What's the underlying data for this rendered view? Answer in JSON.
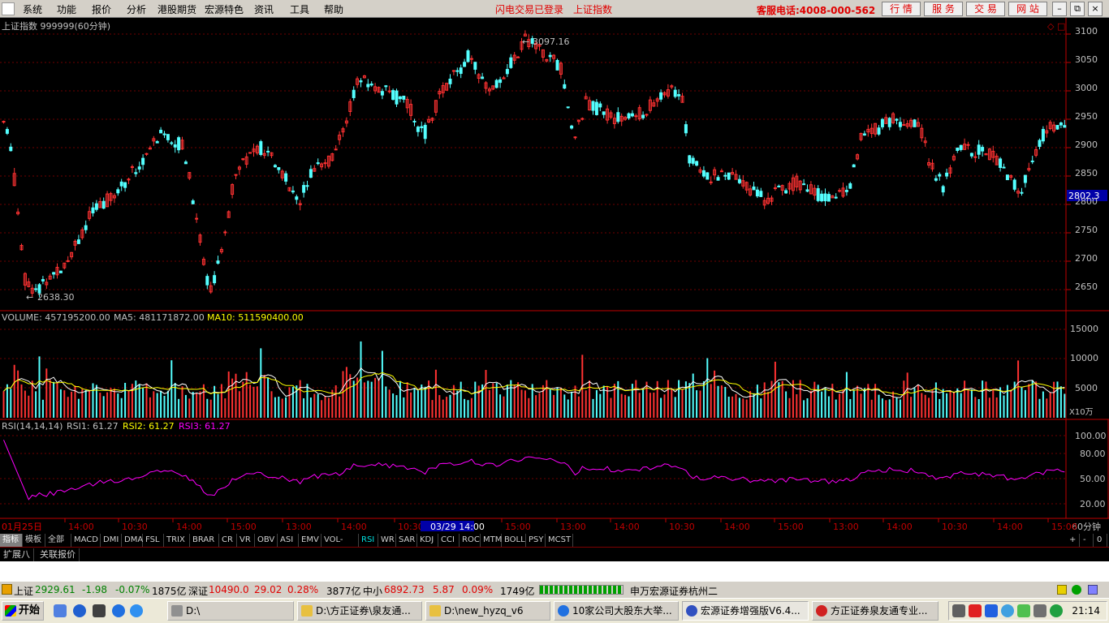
{
  "menubar": {
    "items": [
      "系统",
      "功能",
      "报价",
      "分析",
      "港股期货",
      "宏源特色",
      "资讯",
      "工具",
      "帮助"
    ],
    "status_login": "闪电交易已登录",
    "status_index": "上证指数",
    "hotline": "客服电话:4008-000-562",
    "right_buttons": [
      "行 情",
      "服 务",
      "交 易",
      "网 站"
    ],
    "window_buttons": [
      "minimize",
      "restore",
      "close"
    ]
  },
  "chart": {
    "title": "上证指数 999999(60分钟)",
    "high_label": "3097.16",
    "low_label": "2638.30",
    "current_price": "2802.3",
    "price_ticks": [
      "3100",
      "3050",
      "3000",
      "2950",
      "2900",
      "2850",
      "2800",
      "2750",
      "2700",
      "2650"
    ],
    "volume_label": "VOLUME: 457195200.00",
    "ma5_label": "MA5: 481171872.00",
    "ma10_label": "MA10: 511590400.00",
    "volume_ticks": [
      "15000",
      "10000",
      "5000"
    ],
    "volume_unit": "X10万",
    "rsi_label": "RSI(14,14,14)",
    "rsi1_label": "RSI1: 61.27",
    "rsi2_label": "RSI2: 61.27",
    "rsi3_label": "RSI3: 61.27",
    "rsi_ticks": [
      "100.00",
      "80.00",
      "50.00",
      "20.00"
    ],
    "time_labels": [
      "01月25日",
      "14:00",
      "10:30",
      "14:00",
      "15:00",
      "13:00",
      "14:00",
      "10:30",
      "03/29 14:00",
      "15:00",
      "13:00",
      "14:00",
      "10:30",
      "14:00",
      "15:00",
      "13:00",
      "14:00",
      "10:30",
      "14:00",
      "15:00"
    ],
    "period": "60分钟",
    "colors": {
      "up": "#ff3232",
      "down": "#54ffff",
      "ma5": "#ffffff",
      "ma10": "#ffff00",
      "rsi": "#ff00ff",
      "grid": "#800000"
    }
  },
  "tabs": [
    "指标",
    "模板",
    "全部",
    "MACD",
    "DMI",
    "DMA",
    "FSL",
    "TRIX",
    "BRAR",
    "CR",
    "VR",
    "OBV",
    "ASI",
    "EMV",
    "VOL-TDX",
    "RSI",
    "WR",
    "SAR",
    "KDJ",
    "CCI",
    "ROC",
    "MTM",
    "BOLL",
    "PSY",
    "MCST"
  ],
  "tab_controls": [
    "+",
    "-",
    "0"
  ],
  "ext_tabs": [
    "扩展八",
    "关联报价"
  ],
  "statusbar": {
    "sh_name": "上证",
    "sh_value": "2929.61",
    "sh_change": "-1.98",
    "sh_pct": "-0.07%",
    "sh_amount": "1875亿",
    "sz_name": "深证",
    "sz_value": "10490.0",
    "sz_change": "29.02",
    "sz_pct": "0.28%",
    "sz_amount": "3877亿",
    "zx_name": "中小",
    "zx_value": "6892.73",
    "zx_change": "5.87",
    "zx_pct": "0.09%",
    "zx_amount": "1749亿",
    "broker": "申万宏源证券杭州二"
  },
  "taskbar": {
    "start": "开始",
    "tasks": [
      "D:\\",
      "D:\\方正证券\\泉友通...",
      "D:\\new_hyzq_v6",
      "10家公司大股东大举...",
      "宏源证券增强版V6.4...",
      "方正证券泉友通专业..."
    ],
    "clock": "21:14"
  }
}
